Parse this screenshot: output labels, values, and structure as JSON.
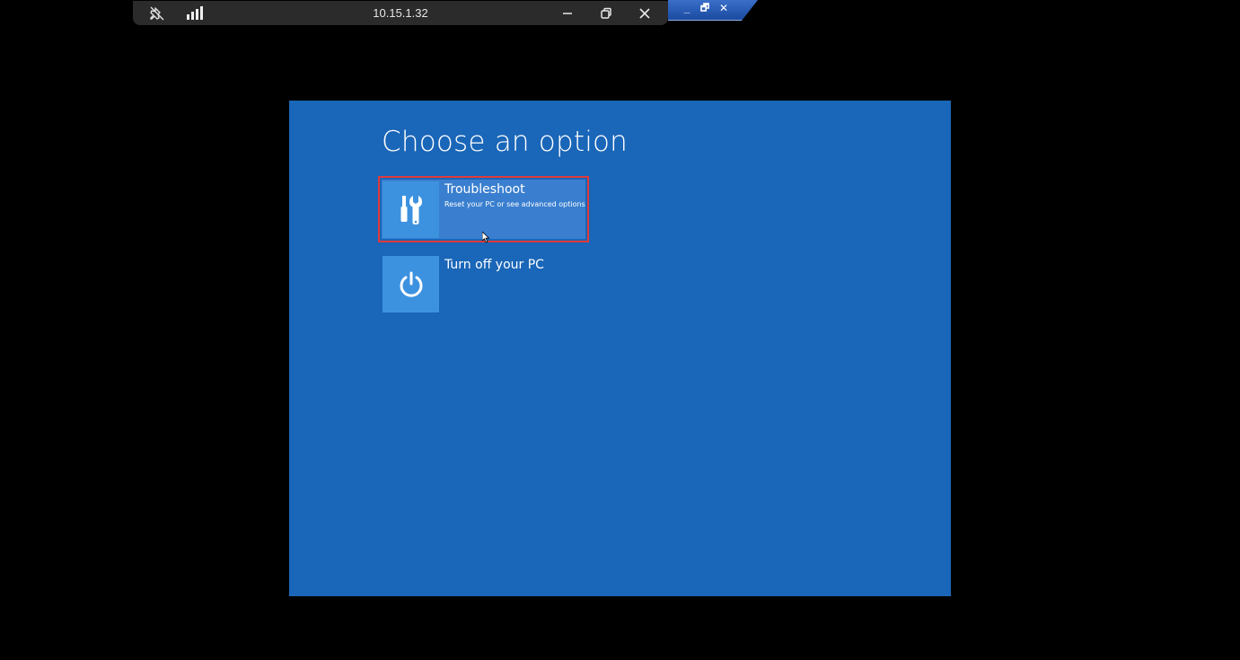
{
  "remote_bar": {
    "address": "10.15.1.32",
    "icons": {
      "pin": "pin-off-icon",
      "signal": "connection-signal-icon",
      "minimize": "minimize-icon",
      "restore": "restore-icon",
      "close": "close-icon"
    }
  },
  "host_titlebar": {
    "minimize": "_",
    "restore": "🗗",
    "close": "✕"
  },
  "recovery": {
    "title": "Choose an option",
    "background_color": "#1a66b8",
    "options": [
      {
        "label": "Troubleshoot",
        "sublabel": "Reset your PC or see advanced options",
        "icon": "tools-icon",
        "selected": true
      },
      {
        "label": "Turn off your PC",
        "icon": "power-icon",
        "selected": false
      }
    ]
  }
}
